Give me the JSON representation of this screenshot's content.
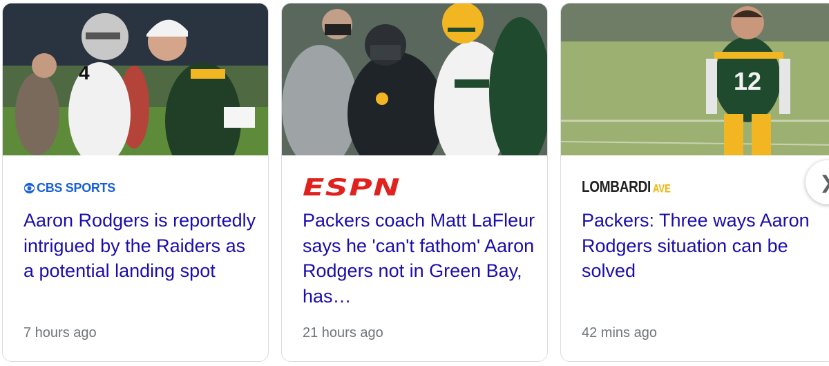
{
  "cards": [
    {
      "source": "CBS SPORTS",
      "headline": "Aaron Rodgers is reportedly intrigued by the Raiders as a potential landing spot",
      "time": "7 hours ago",
      "thumbnail_icon": "photo-rodgers-carr-handshake"
    },
    {
      "source": "ESPN",
      "headline": "Packers coach Matt LaFleur says he 'can't fathom' Aaron Rodgers not in Green Bay, has…",
      "time": "21 hours ago",
      "thumbnail_icon": "photo-lafleur-rodgers"
    },
    {
      "source_main": "LOMBARDI",
      "source_accent": "AVE",
      "headline": "Packers: Three ways Aaron Rodgers situation can be solved",
      "time": "42 mins ago",
      "thumbnail_icon": "photo-rodgers-field"
    }
  ],
  "next_icon": "chevron-right-icon",
  "colors": {
    "headline": "#1a0dab",
    "time": "#70757a",
    "cbs": "#1660d8",
    "espn": "#e0221e",
    "lombardi_accent": "#f2b300",
    "packers_green": "#1f4a2d",
    "packers_gold": "#f3b623"
  }
}
